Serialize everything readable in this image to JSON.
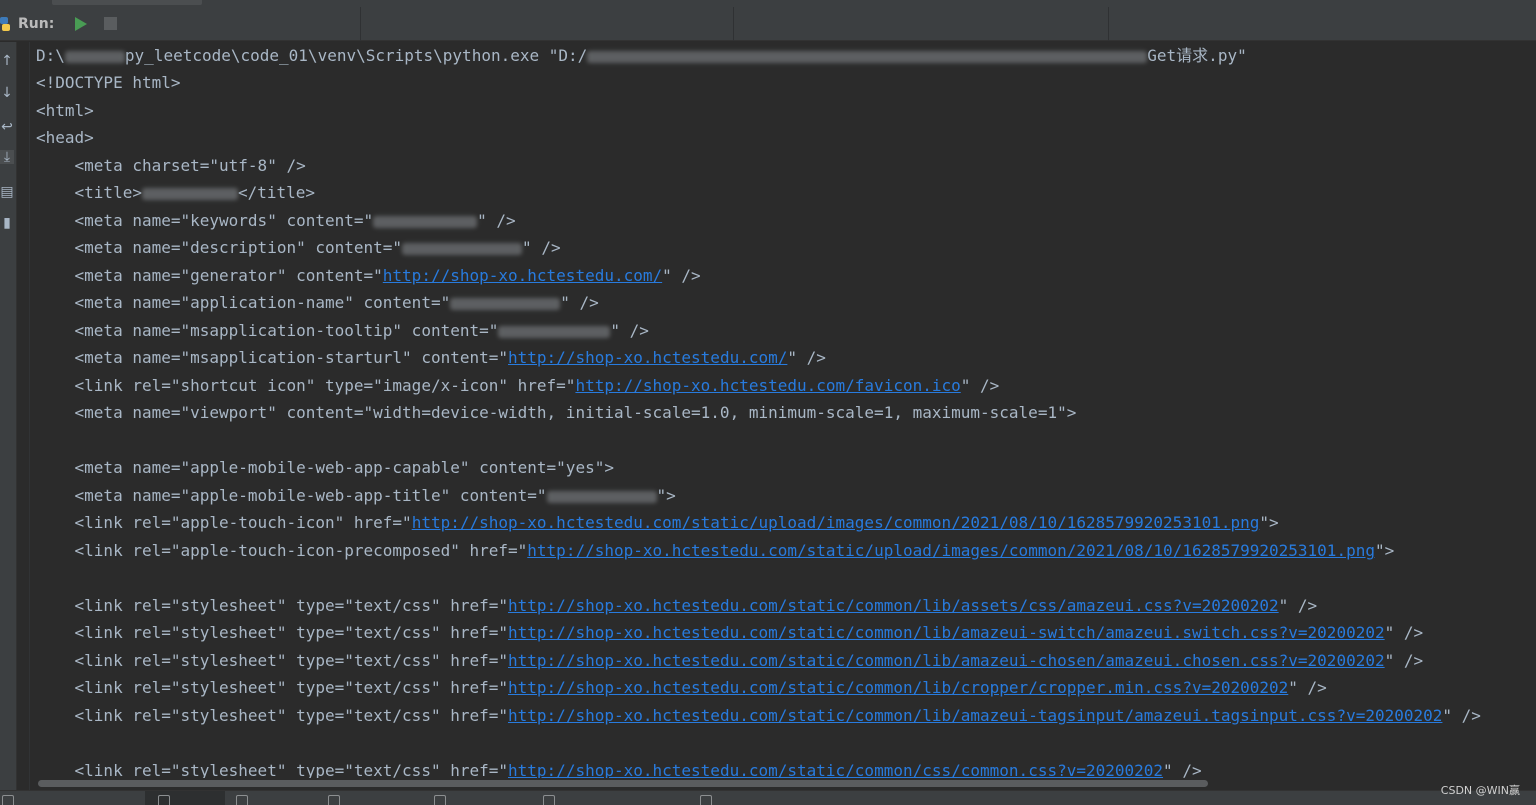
{
  "toolbar": {
    "run_label": "Run:"
  },
  "console": {
    "line01": {
      "a": "D:\\",
      "b": "py_leetcode\\code_01\\venv\\Scripts\\python.exe \"D:/",
      "c": "Get请求.py\""
    },
    "line02": "<!DOCTYPE html>",
    "line03": "<html>",
    "line04": "<head>",
    "line05": "    <meta charset=\"utf-8\" />",
    "line06": {
      "a": "    <title>",
      "b": "</title>"
    },
    "line07": {
      "a": "    <meta name=\"keywords\" content=\"",
      "b": "\" />"
    },
    "line08": {
      "a": "    <meta name=\"description\" content=\"",
      "b": "\" />"
    },
    "line09": {
      "a": "    <meta name=\"generator\" content=\"",
      "link": "http://shop-xo.hctestedu.com/",
      "b": "\" />"
    },
    "line10": {
      "a": "    <meta name=\"application-name\" content=\"",
      "b": "\" />"
    },
    "line11": {
      "a": "    <meta name=\"msapplication-tooltip\" content=\"",
      "b": "\" />"
    },
    "line12": {
      "a": "    <meta name=\"msapplication-starturl\" content=\"",
      "link": "http://shop-xo.hctestedu.com/",
      "b": "\" />"
    },
    "line13": {
      "a": "    <link rel=\"shortcut icon\" type=\"image/x-icon\" href=\"",
      "link": "http://shop-xo.hctestedu.com/favicon.ico",
      "b": "\" />"
    },
    "line14": "    <meta name=\"viewport\" content=\"width=device-width, initial-scale=1.0, minimum-scale=1, maximum-scale=1\">",
    "line16": "    <meta name=\"apple-mobile-web-app-capable\" content=\"yes\">",
    "line17": {
      "a": "    <meta name=\"apple-mobile-web-app-title\" content=\"",
      "b": "\">"
    },
    "line18": {
      "a": "    <link rel=\"apple-touch-icon\" href=\"",
      "link": "http://shop-xo.hctestedu.com/static/upload/images/common/2021/08/10/1628579920253101.png",
      "b": "\">"
    },
    "line19": {
      "a": "    <link rel=\"apple-touch-icon-precomposed\" href=\"",
      "link": "http://shop-xo.hctestedu.com/static/upload/images/common/2021/08/10/1628579920253101.png",
      "b": "\">"
    },
    "line21": {
      "a": "    <link rel=\"stylesheet\" type=\"text/css\" href=\"",
      "link": "http://shop-xo.hctestedu.com/static/common/lib/assets/css/amazeui.css?v=20200202",
      "b": "\" />"
    },
    "line22": {
      "a": "    <link rel=\"stylesheet\" type=\"text/css\" href=\"",
      "link": "http://shop-xo.hctestedu.com/static/common/lib/amazeui-switch/amazeui.switch.css?v=20200202",
      "b": "\" />"
    },
    "line23": {
      "a": "    <link rel=\"stylesheet\" type=\"text/css\" href=\"",
      "link": "http://shop-xo.hctestedu.com/static/common/lib/amazeui-chosen/amazeui.chosen.css?v=20200202",
      "b": "\" />"
    },
    "line24": {
      "a": "    <link rel=\"stylesheet\" type=\"text/css\" href=\"",
      "link": "http://shop-xo.hctestedu.com/static/common/lib/cropper/cropper.min.css?v=20200202",
      "b": "\" />"
    },
    "line25": {
      "a": "    <link rel=\"stylesheet\" type=\"text/css\" href=\"",
      "link": "http://shop-xo.hctestedu.com/static/common/lib/amazeui-tagsinput/amazeui.tagsinput.css?v=20200202",
      "b": "\" />"
    },
    "line27": {
      "a": "    <link rel=\"stylesheet\" type=\"text/css\" href=\"",
      "link": "http://shop-xo.hctestedu.com/static/common/css/common.css?v=20200202",
      "b": "\" />"
    }
  },
  "watermark": "CSDN @WIN赢",
  "colors": {
    "background": "#2b2b2b",
    "text": "#a9b7c6",
    "link": "#287bde",
    "run_green": "#499c54"
  },
  "icons": [
    "python-icon",
    "play-icon",
    "stop-icon",
    "arrow-up-icon",
    "arrow-down-icon",
    "soft-wrap-icon",
    "scroll-to-end-icon",
    "print-icon",
    "trash-icon"
  ]
}
